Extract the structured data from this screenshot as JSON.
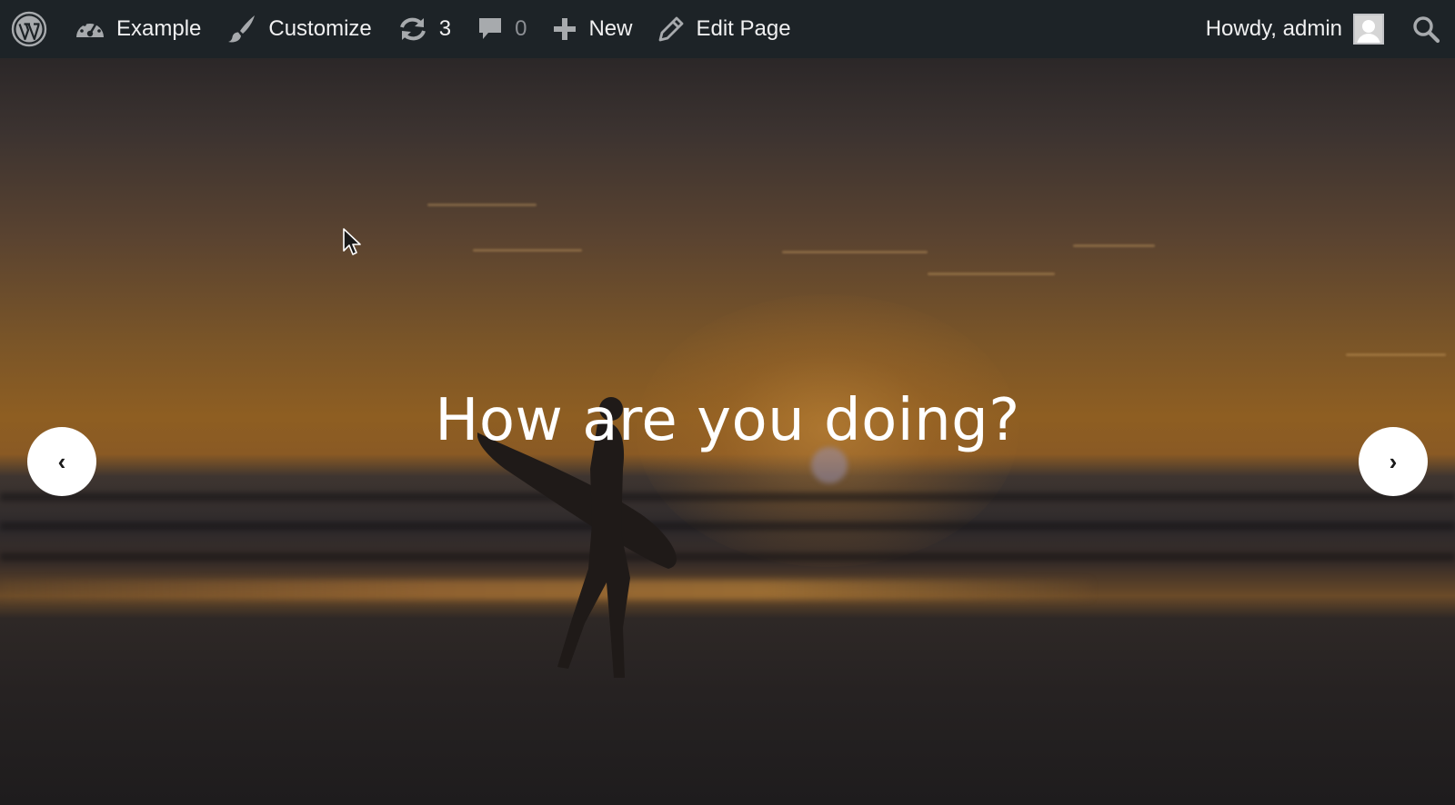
{
  "adminbar": {
    "logo_icon": "wordpress-logo-icon",
    "site": {
      "icon": "dashboard-icon",
      "label": "Example"
    },
    "customize": {
      "icon": "brush-icon",
      "label": "Customize"
    },
    "updates": {
      "icon": "updates-icon",
      "count": "3"
    },
    "comments": {
      "icon": "comment-icon",
      "count": "0"
    },
    "new": {
      "icon": "plus-icon",
      "label": "New"
    },
    "edit": {
      "icon": "pencil-icon",
      "label": "Edit Page"
    },
    "account": {
      "greeting": "Howdy, admin",
      "avatar_icon": "avatar-icon"
    },
    "search": {
      "icon": "search-icon"
    },
    "colors": {
      "bar_bg": "#1d2327",
      "text": "#f0f0f1",
      "icon": "#a7aaad",
      "muted": "#8c8f94"
    }
  },
  "hero": {
    "title": "How are you doing?",
    "prev_label": "‹",
    "next_label": "›",
    "image_subject": "surfer-silhouette-at-sunset-beach"
  }
}
